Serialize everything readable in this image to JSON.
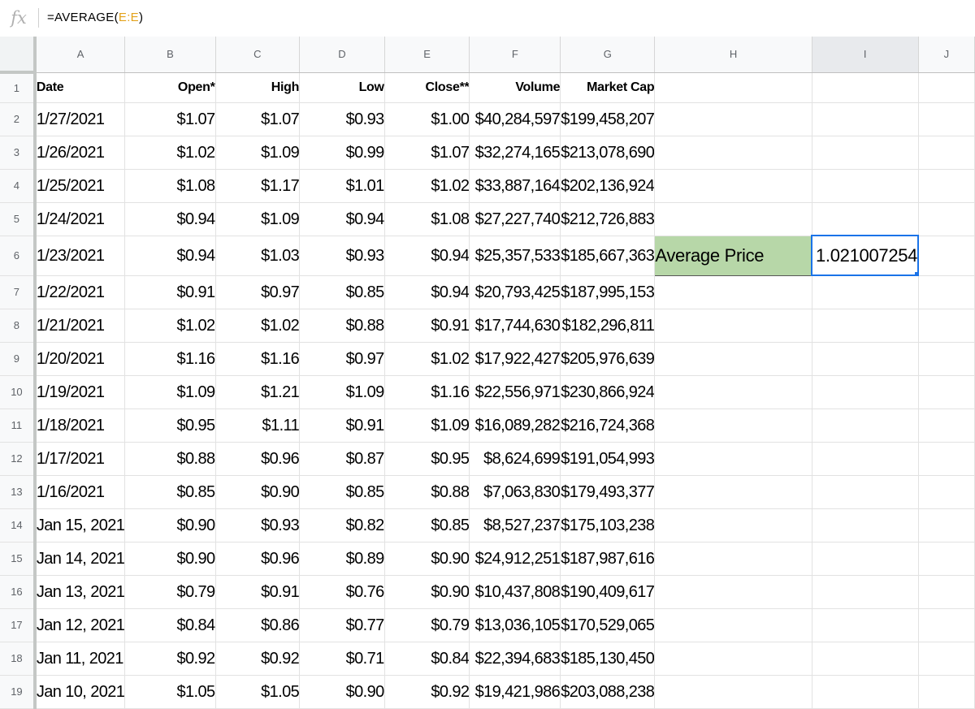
{
  "formula_bar": {
    "icon": "function-icon",
    "icon_glyph": "fx",
    "formula_prefix": "=AVERAGE(",
    "formula_ref1": "E",
    "formula_sep": ":",
    "formula_ref2": "E",
    "formula_suffix": ")"
  },
  "columns": [
    "A",
    "B",
    "C",
    "D",
    "E",
    "F",
    "G",
    "H",
    "I",
    "J"
  ],
  "header_row": {
    "row": "1",
    "cells": [
      "Date",
      "Open*",
      "High",
      "Low",
      "Close**",
      "Volume",
      "Market Cap"
    ]
  },
  "rows": [
    {
      "row": "2",
      "cells": [
        "1/27/2021",
        "$1.07",
        "$1.07",
        "$0.93",
        "$1.00",
        "$40,284,597",
        "$199,458,207"
      ]
    },
    {
      "row": "3",
      "cells": [
        "1/26/2021",
        "$1.02",
        "$1.09",
        "$0.99",
        "$1.07",
        "$32,274,165",
        "$213,078,690"
      ]
    },
    {
      "row": "4",
      "cells": [
        "1/25/2021",
        "$1.08",
        "$1.17",
        "$1.01",
        "$1.02",
        "$33,887,164",
        "$202,136,924"
      ]
    },
    {
      "row": "5",
      "cells": [
        "1/24/2021",
        "$0.94",
        "$1.09",
        "$0.94",
        "$1.08",
        "$27,227,740",
        "$212,726,883"
      ]
    },
    {
      "row": "6",
      "cells": [
        "1/23/2021",
        "$0.94",
        "$1.03",
        "$0.93",
        "$0.94",
        "$25,357,533",
        "$185,667,363"
      ]
    },
    {
      "row": "7",
      "cells": [
        "1/22/2021",
        "$0.91",
        "$0.97",
        "$0.85",
        "$0.94",
        "$20,793,425",
        "$187,995,153"
      ]
    },
    {
      "row": "8",
      "cells": [
        "1/21/2021",
        "$1.02",
        "$1.02",
        "$0.88",
        "$0.91",
        "$17,744,630",
        "$182,296,811"
      ]
    },
    {
      "row": "9",
      "cells": [
        "1/20/2021",
        "$1.16",
        "$1.16",
        "$0.97",
        "$1.02",
        "$17,922,427",
        "$205,976,639"
      ]
    },
    {
      "row": "10",
      "cells": [
        "1/19/2021",
        "$1.09",
        "$1.21",
        "$1.09",
        "$1.16",
        "$22,556,971",
        "$230,866,924"
      ]
    },
    {
      "row": "11",
      "cells": [
        "1/18/2021",
        "$0.95",
        "$1.11",
        "$0.91",
        "$1.09",
        "$16,089,282",
        "$216,724,368"
      ]
    },
    {
      "row": "12",
      "cells": [
        "1/17/2021",
        "$0.88",
        "$0.96",
        "$0.87",
        "$0.95",
        "$8,624,699",
        "$191,054,993"
      ]
    },
    {
      "row": "13",
      "cells": [
        "1/16/2021",
        "$0.85",
        "$0.90",
        "$0.85",
        "$0.88",
        "$7,063,830",
        "$179,493,377"
      ]
    },
    {
      "row": "14",
      "cells": [
        "Jan 15, 2021",
        "$0.90",
        "$0.93",
        "$0.82",
        "$0.85",
        "$8,527,237",
        "$175,103,238"
      ]
    },
    {
      "row": "15",
      "cells": [
        "Jan 14, 2021",
        "$0.90",
        "$0.96",
        "$0.89",
        "$0.90",
        "$24,912,251",
        "$187,987,616"
      ]
    },
    {
      "row": "16",
      "cells": [
        "Jan 13, 2021",
        "$0.79",
        "$0.91",
        "$0.76",
        "$0.90",
        "$10,437,808",
        "$190,409,617"
      ]
    },
    {
      "row": "17",
      "cells": [
        "Jan 12, 2021",
        "$0.84",
        "$0.86",
        "$0.77",
        "$0.79",
        "$13,036,105",
        "$170,529,065"
      ]
    },
    {
      "row": "18",
      "cells": [
        "Jan 11, 2021",
        "$0.92",
        "$0.92",
        "$0.71",
        "$0.84",
        "$22,394,683",
        "$185,130,450"
      ]
    },
    {
      "row": "19",
      "cells": [
        "Jan 10, 2021",
        "$1.05",
        "$1.05",
        "$0.90",
        "$0.92",
        "$19,421,986",
        "$203,088,238"
      ]
    }
  ],
  "summary": {
    "label": "Average Price",
    "value": "1.021007254",
    "label_fill": "#b7d7a8",
    "selection_color": "#1a73e8"
  }
}
